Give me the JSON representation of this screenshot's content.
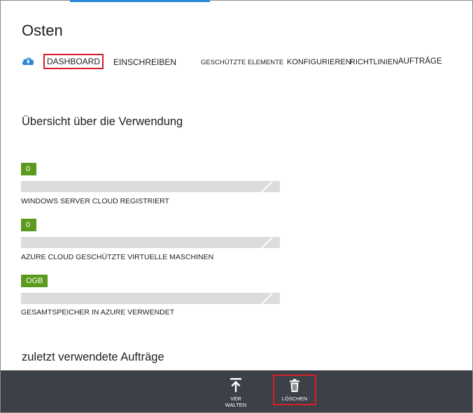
{
  "header": {
    "title": "Osten"
  },
  "nav": {
    "icon": "cloud-lightning-icon",
    "items": [
      {
        "label": "DASHBOARD",
        "active": true
      },
      {
        "label": "EINSCHREIBEN"
      },
      {
        "label": "GESCHÜTZTE ELEMENTE"
      },
      {
        "label": "KONFIGURIEREN"
      },
      {
        "label": "RICHTLINIEN"
      },
      {
        "label": "AUFTRÄGE"
      }
    ]
  },
  "usage": {
    "heading": "Übersicht über die Verwendung",
    "metrics": [
      {
        "value": "0",
        "label": "WINDOWS SERVER CLOUD REGISTRIERT",
        "fill_fraction": 0
      },
      {
        "value": "0",
        "label": "AZURE CLOUD GESCHÜTZTE VIRTUELLE MASCHINEN",
        "fill_fraction": 0
      },
      {
        "value": "OGB",
        "label": "GESAMTSPEICHER IN AZURE VERWENDET",
        "fill_fraction": 0
      }
    ]
  },
  "jobs": {
    "heading": "zuletzt verwendete Aufträge"
  },
  "command_bar": {
    "manage_label_line1": "VER",
    "manage_label_line2": "WALTEN",
    "manage_icon": "upload-arrow-icon",
    "delete_label": "LÖSCHEN",
    "delete_icon": "trash-icon"
  },
  "colors": {
    "accent_green": "#5c9a1e",
    "highlight_red": "#d81e2a",
    "command_bar_bg": "#3c4047",
    "bar_bg": "#dcdcdc",
    "icon_blue": "#2b88d8"
  }
}
